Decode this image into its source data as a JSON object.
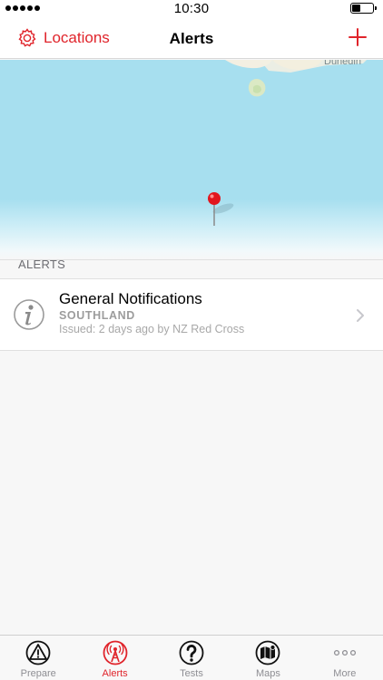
{
  "status_bar": {
    "time": "10:30"
  },
  "nav": {
    "back_label": "Locations",
    "title": "Alerts"
  },
  "map": {
    "place_label": "Dunedin"
  },
  "alerts_section": {
    "header": "ALERTS",
    "items": [
      {
        "title": "General Notifications",
        "region": "SOUTHLAND",
        "issued": "Issued: 2 days ago by NZ Red Cross"
      }
    ]
  },
  "tab_bar": {
    "tabs": [
      {
        "label": "Prepare",
        "icon": "prepare-icon",
        "active": false
      },
      {
        "label": "Alerts",
        "icon": "alerts-tower-icon",
        "active": true
      },
      {
        "label": "Tests",
        "icon": "question-icon",
        "active": false
      },
      {
        "label": "Maps",
        "icon": "map-book-icon",
        "active": false
      },
      {
        "label": "More",
        "icon": "more-dots-icon",
        "active": false
      }
    ]
  },
  "colors": {
    "accent": "#e0242b",
    "map_water": "#a7dfef",
    "land": "#f3efe2"
  }
}
